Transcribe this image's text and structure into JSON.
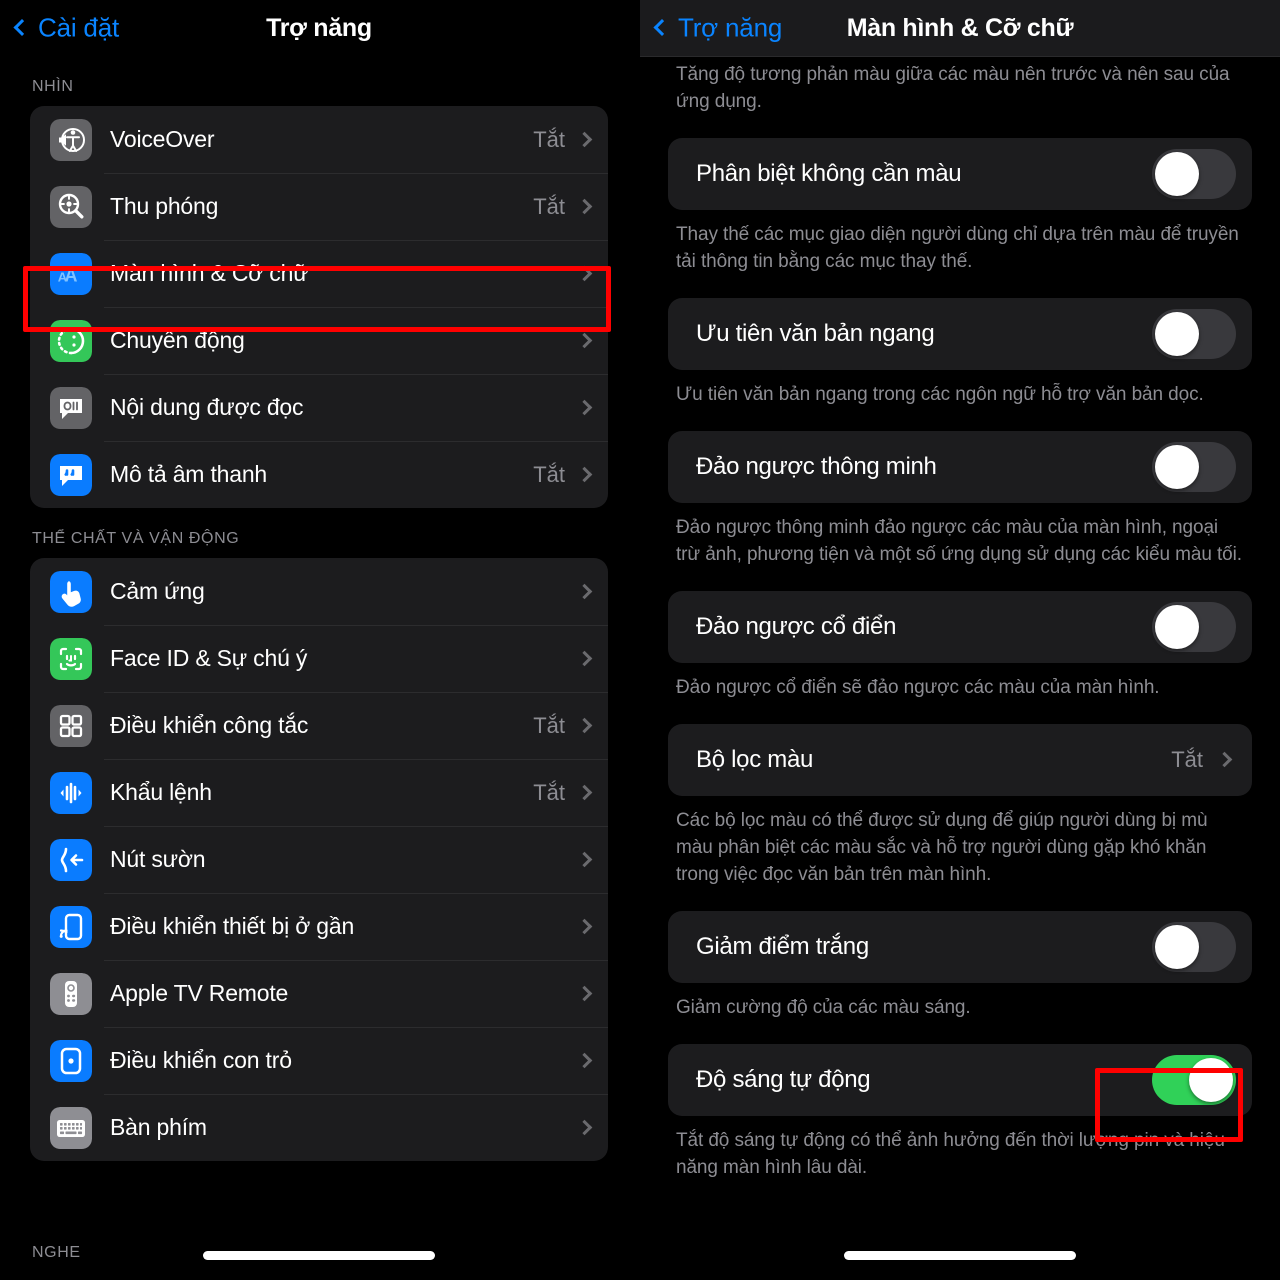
{
  "left_panel": {
    "nav": {
      "back_label": "Cài đặt",
      "title": "Trợ năng",
      "back_icon": "chevron-left-icon"
    },
    "sections": [
      {
        "header": "NHÌN",
        "rows": [
          {
            "label": "VoiceOver",
            "value": "Tắt",
            "icon": "voiceover-icon",
            "icon_color": "#636366"
          },
          {
            "label": "Thu phóng",
            "value": "Tắt",
            "icon": "zoom-icon",
            "icon_color": "#636366"
          },
          {
            "label": "Màn hình & Cỡ chữ",
            "value": "",
            "icon": "display-text-aa-icon",
            "icon_color": "#0a7cff"
          },
          {
            "label": "Chuyển động",
            "value": "",
            "icon": "motion-icon",
            "icon_color": "#34c759"
          },
          {
            "label": "Nội dung được đọc",
            "value": "",
            "icon": "spoken-content-icon",
            "icon_color": "#636366"
          },
          {
            "label": "Mô tả âm thanh",
            "value": "Tắt",
            "icon": "audio-description-icon",
            "icon_color": "#0a7cff"
          }
        ]
      },
      {
        "header": "THỂ CHẤT VÀ VẬN ĐỘNG",
        "rows": [
          {
            "label": "Cảm ứng",
            "value": "",
            "icon": "touch-icon",
            "icon_color": "#0a7cff"
          },
          {
            "label": "Face ID & Sự chú ý",
            "value": "",
            "icon": "face-id-icon",
            "icon_color": "#34c759"
          },
          {
            "label": "Điều khiển công tắc",
            "value": "Tắt",
            "icon": "switch-control-icon",
            "icon_color": "#636366"
          },
          {
            "label": "Khẩu lệnh",
            "value": "Tắt",
            "icon": "voice-control-icon",
            "icon_color": "#0a7cff"
          },
          {
            "label": "Nút sườn",
            "value": "",
            "icon": "side-button-icon",
            "icon_color": "#0a7cff"
          },
          {
            "label": "Điều khiển thiết bị ở gần",
            "value": "",
            "icon": "nearby-device-icon",
            "icon_color": "#0a7cff"
          },
          {
            "label": "Apple TV Remote",
            "value": "",
            "icon": "apple-tv-remote-icon",
            "icon_color": "#8e8e93"
          },
          {
            "label": "Điều khiển con trỏ",
            "value": "",
            "icon": "pointer-control-icon",
            "icon_color": "#0a7cff"
          },
          {
            "label": "Bàn phím",
            "value": "",
            "icon": "keyboard-icon",
            "icon_color": "#8e8e93"
          }
        ]
      }
    ],
    "bottom_label": "NGHE",
    "highlight_target": "Màn hình & Cỡ chữ"
  },
  "right_panel": {
    "nav": {
      "back_label": "Trợ năng",
      "title": "Màn hình & Cỡ chữ",
      "back_icon": "chevron-left-icon"
    },
    "top_footnote": "Tăng độ tương phản màu giữa các màu nên trước và nên sau của ứng dụng.",
    "items": [
      {
        "kind": "switch",
        "label": "Phân biệt không cần màu",
        "state": "off",
        "footnote": "Thay thế các mục giao diện người dùng chỉ dựa trên màu để truyền tải thông tin bằng các mục thay thế."
      },
      {
        "kind": "switch",
        "label": "Ưu tiên văn bản ngang",
        "state": "off",
        "footnote": "Ưu tiên văn bản ngang trong các ngôn ngữ hỗ trợ văn bản dọc."
      },
      {
        "kind": "switch",
        "label": "Đảo ngược thông minh",
        "state": "off",
        "footnote": "Đảo ngược thông minh đảo ngược các màu của màn hình, ngoại trừ ảnh, phương tiện và một số ứng dụng sử dụng các kiểu màu tối."
      },
      {
        "kind": "switch",
        "label": "Đảo ngược cổ điển",
        "state": "off",
        "footnote": "Đảo ngược cổ điển sẽ đảo ngược các màu của màn hình."
      },
      {
        "kind": "disclosure",
        "label": "Bộ lọc màu",
        "value": "Tắt",
        "footnote": "Các bộ lọc màu có thể được sử dụng để giúp người dùng bị mù màu phân biệt các màu sắc và hỗ trợ người dùng gặp khó khăn trong việc đọc văn bản trên màn hình."
      },
      {
        "kind": "switch",
        "label": "Giảm điểm trắng",
        "state": "off",
        "footnote": "Giảm cường độ của các màu sáng."
      },
      {
        "kind": "switch",
        "label": "Độ sáng tự động",
        "state": "on",
        "footnote": "Tắt độ sáng tự động có thể ảnh hưởng đến thời lượng pin và hiệu năng màn hình lâu dài."
      }
    ],
    "highlight_target": "Độ sáng tự động"
  },
  "colors": {
    "accent_blue": "#0a84ff",
    "toggle_on_green": "#30d158",
    "toggle_off_track": "#39393d",
    "highlight_red": "#ff0000",
    "card_background": "#1c1c1e",
    "page_background": "#000000",
    "secondary_text": "#8d8d93"
  }
}
